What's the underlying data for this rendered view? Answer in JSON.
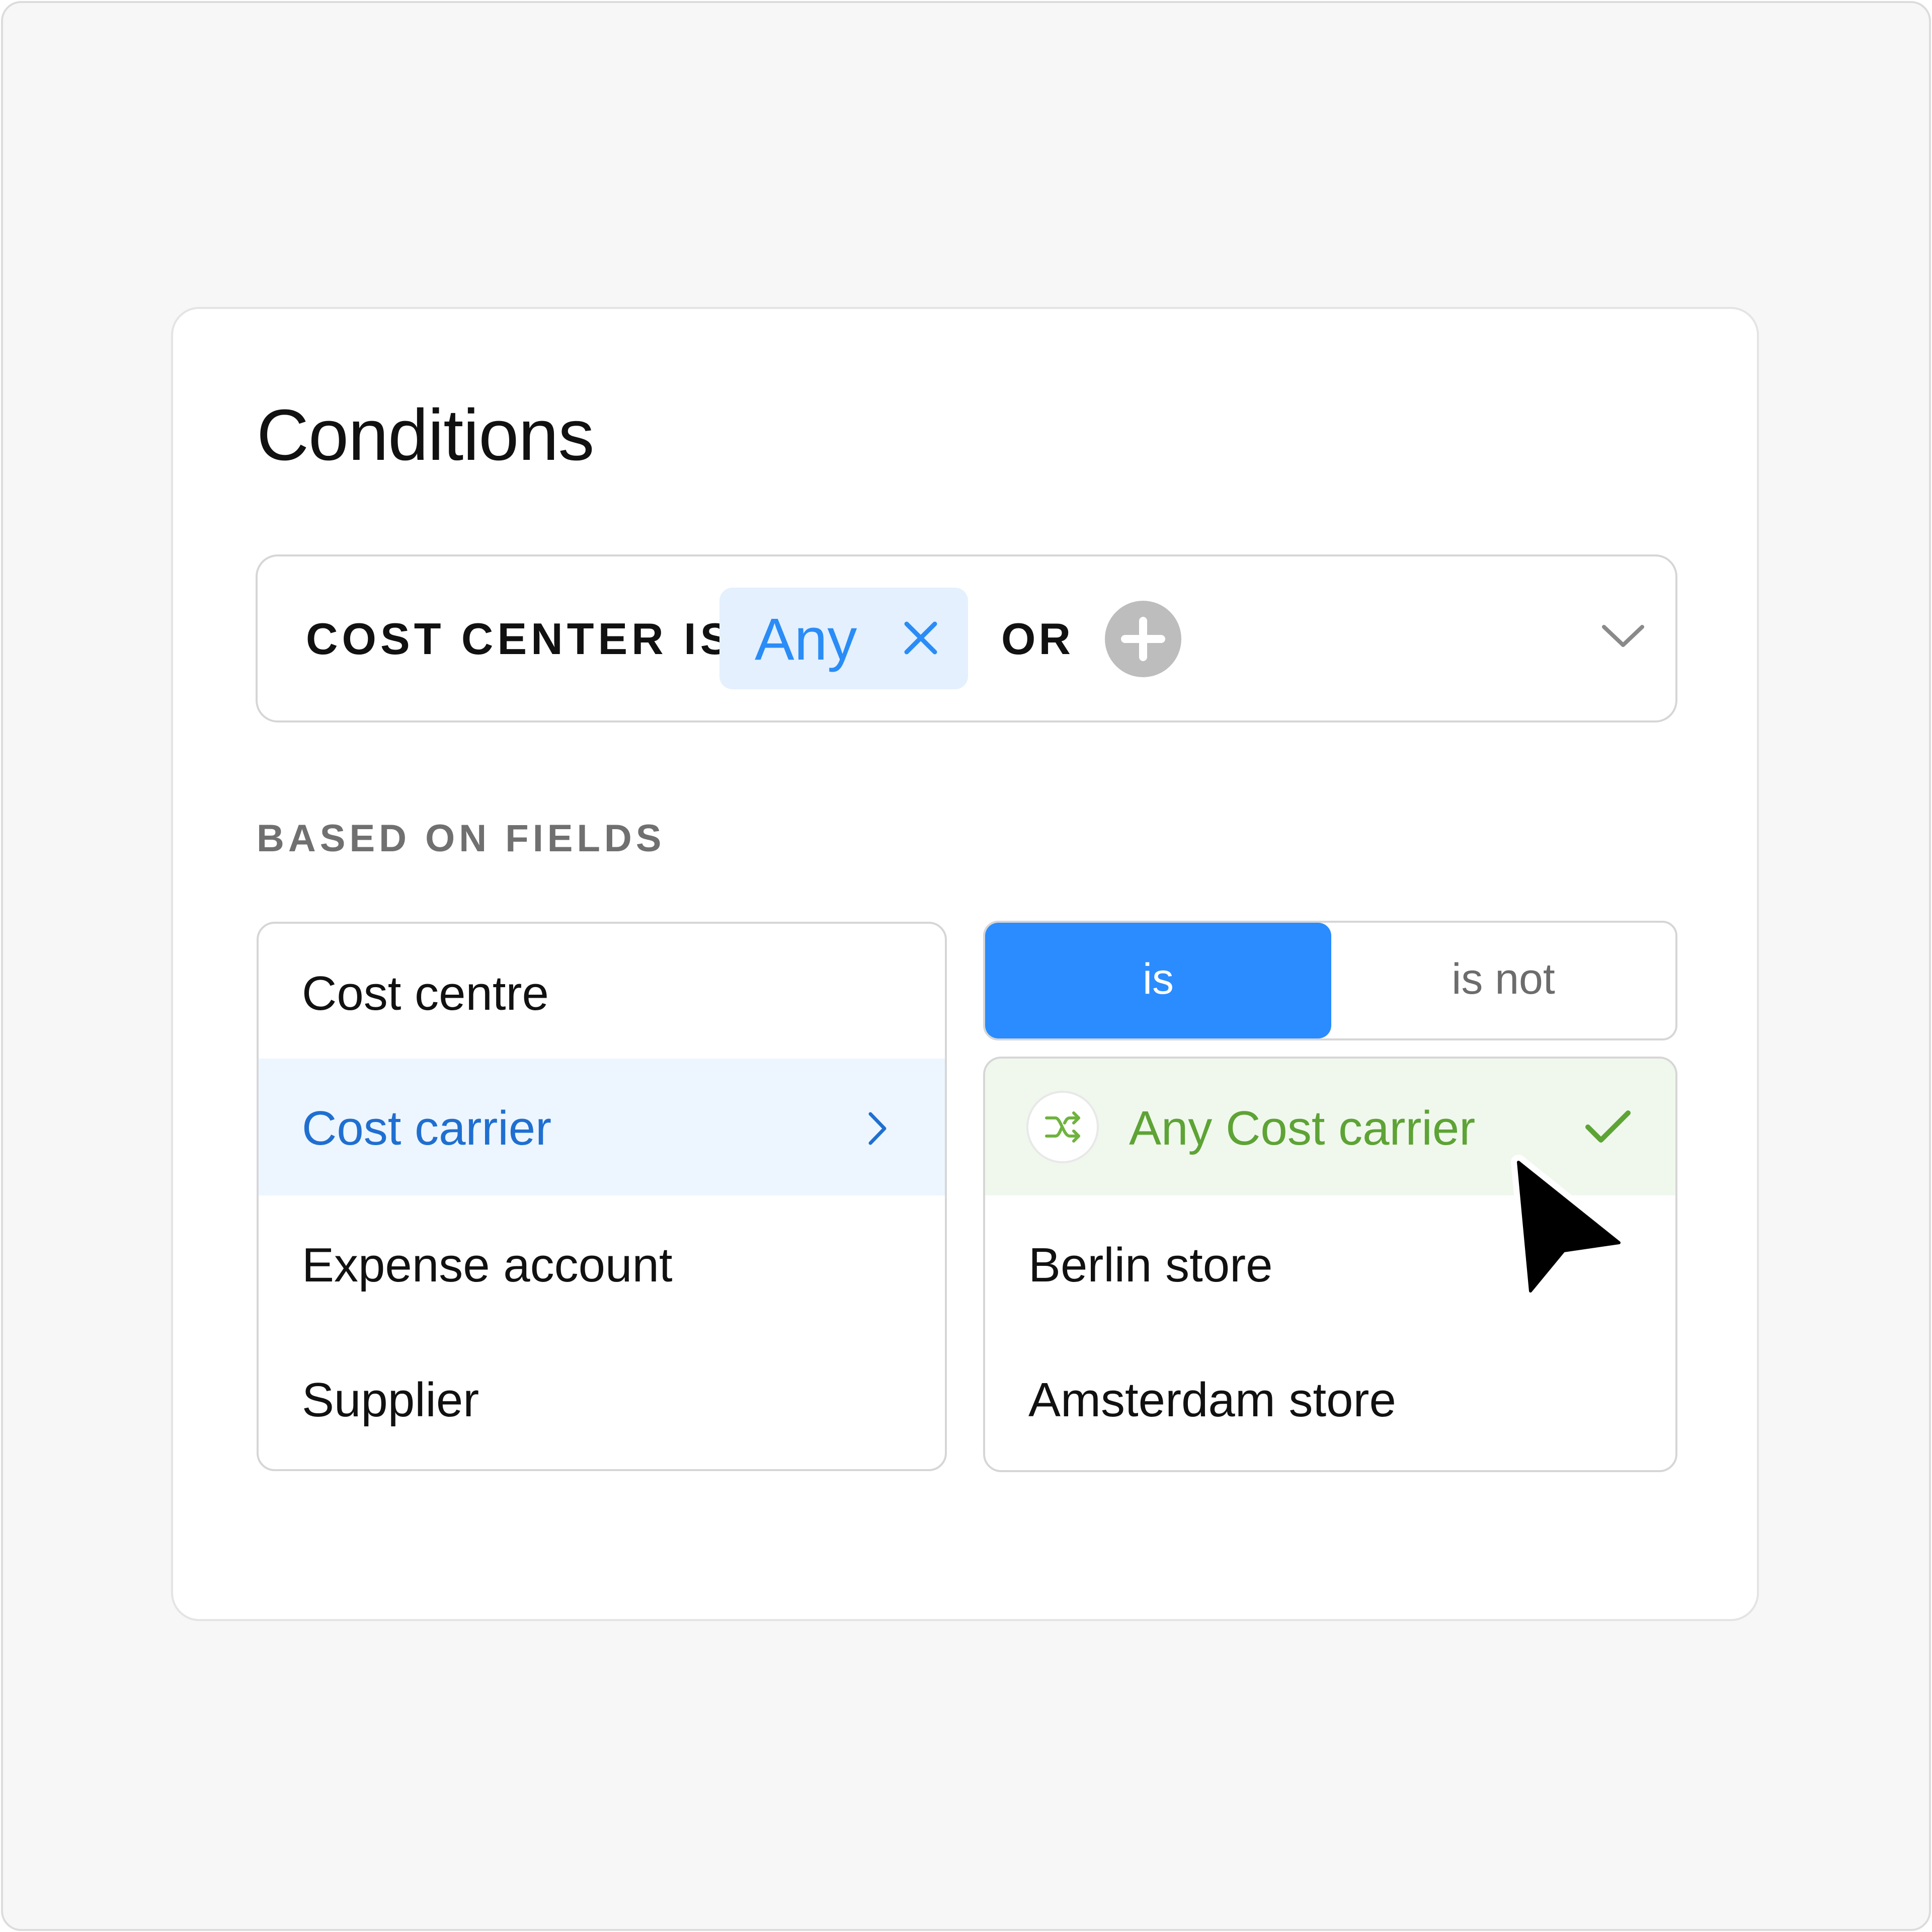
{
  "title": "Conditions",
  "condition": {
    "label": "COST CENTER IS",
    "chip_label": "Any",
    "or_label": "OR"
  },
  "section_label": "BASED ON FIELDS",
  "fields": [
    {
      "label": "Cost centre",
      "active": false
    },
    {
      "label": "Cost carrier",
      "active": true
    },
    {
      "label": "Expense account",
      "active": false
    },
    {
      "label": "Supplier",
      "active": false
    }
  ],
  "operator": {
    "options": [
      "is",
      "is not"
    ],
    "selected": "is"
  },
  "options": [
    {
      "label": "Any Cost carrier",
      "selected": true
    },
    {
      "label": "Berlin store",
      "selected": false
    },
    {
      "label": "Amsterdam store",
      "selected": false
    }
  ],
  "colors": {
    "accent_blue": "#2a8cff",
    "active_text_blue": "#1f6fd1",
    "selected_green": "#5da335",
    "selected_bg": "#f0f8ed",
    "active_bg": "#edf6fe"
  },
  "icons": {
    "chip_remove": "close-icon",
    "add": "plus-icon",
    "expand": "chevron-down-icon",
    "field_next": "chevron-right-icon",
    "any_option": "shuffle-icon",
    "selected_mark": "checkmark-icon",
    "pointer": "cursor-arrow-icon"
  }
}
